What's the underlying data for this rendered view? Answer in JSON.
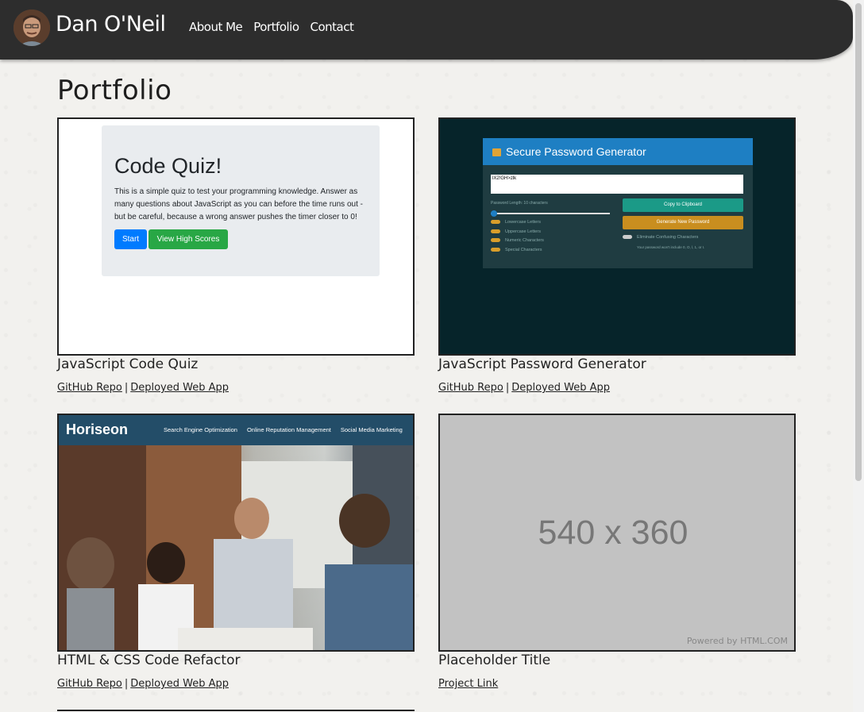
{
  "nav": {
    "brand": "Dan O'Neil",
    "links": [
      "About Me",
      "Portfolio",
      "Contact"
    ]
  },
  "page_title": "Portfolio",
  "projects": [
    {
      "title": "JavaScript Code Quiz",
      "links": [
        "GitHub Repo",
        "Deployed Web App"
      ],
      "thumbnail": {
        "heading": "Code Quiz!",
        "text": "This is a simple quiz to test your programming knowledge. Answer as many questions about JavaScript as you can before the time runs out - but be careful, because a wrong answer pushes the timer closer to 0!",
        "start_label": "Start",
        "high_scores_label": "View High Scores"
      }
    },
    {
      "title": "JavaScript Password Generator",
      "links": [
        "GitHub Repo",
        "Deployed Web App"
      ],
      "thumbnail": {
        "heading": "Secure Password Generator",
        "output": "lX2!GH>zlk",
        "length_label": "Password Length: 10 characters",
        "options": [
          "Lowercase Letters",
          "Uppercase Letters",
          "Numeric Characters",
          "Special Characters"
        ],
        "copy_label": "Copy to Clipboard",
        "generate_label": "Generate New Password",
        "confusing_label": "Eliminate Confusing Characters",
        "note": "Your password won't include 0, O, l, 1, or I."
      }
    },
    {
      "title": "HTML & CSS Code Refactor",
      "links": [
        "GitHub Repo",
        "Deployed Web App"
      ],
      "thumbnail": {
        "logo": "Horiseon",
        "nav": [
          "Search Engine Optimization",
          "Online Reputation Management",
          "Social Media Marketing"
        ]
      }
    },
    {
      "title": "Placeholder Title",
      "links": [
        "Project Link"
      ],
      "thumbnail": {
        "text": "540 x 360",
        "powered": "Powered by HTML.COM"
      }
    }
  ],
  "colors": {
    "navbar": "#2d2d2d",
    "page_bg": "#f2f1ee",
    "quiz_start": "#007bff",
    "quiz_high_scores": "#28a745",
    "pw_header": "#1e7fc3",
    "pw_bg": "#06242a",
    "horiseon_header": "#234d68",
    "placeholder_bg": "#c2c2c2"
  }
}
